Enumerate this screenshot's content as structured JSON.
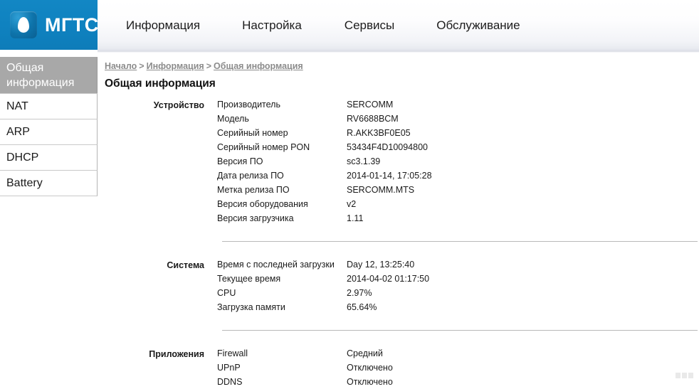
{
  "brand": {
    "name": "МГТС",
    "logo_icon": "egg-drop-icon",
    "logo_bg_color": "#0f82c0"
  },
  "nav": {
    "items": [
      {
        "label": "Информация"
      },
      {
        "label": "Настройка"
      },
      {
        "label": "Сервисы"
      },
      {
        "label": "Обслуживание"
      }
    ]
  },
  "sidebar": {
    "items": [
      {
        "label": "Общая информация",
        "active": true
      },
      {
        "label": "NAT",
        "active": false
      },
      {
        "label": "ARP",
        "active": false
      },
      {
        "label": "DHCP",
        "active": false
      },
      {
        "label": "Battery",
        "active": false
      }
    ],
    "active_bg_color": "#a8a8a8"
  },
  "breadcrumb": {
    "items": [
      {
        "label": "Начало"
      },
      {
        "label": "Информация"
      },
      {
        "label": "Общая информация"
      }
    ],
    "separator": ">"
  },
  "page": {
    "title": "Общая информация"
  },
  "sections": [
    {
      "label": "Устройство",
      "rows": [
        {
          "key": "Производитель",
          "value": "SERCOMM"
        },
        {
          "key": "Модель",
          "value": "RV6688BCM"
        },
        {
          "key": "Серийный номер",
          "value": "R.AKK3BF0E05"
        },
        {
          "key": "Серийный номер PON",
          "value": "53434F4D10094800"
        },
        {
          "key": "Версия ПО",
          "value": "sc3.1.39"
        },
        {
          "key": "Дата релиза ПО",
          "value": "2014-01-14, 17:05:28"
        },
        {
          "key": "Метка релиза ПО",
          "value": "SERCOMM.MTS"
        },
        {
          "key": "Версия оборудования",
          "value": "v2"
        },
        {
          "key": "Версия загрузчика",
          "value": "1.11"
        }
      ]
    },
    {
      "label": "Система",
      "rows": [
        {
          "key": "Время с последней загрузки",
          "value": "Day 12, 13:25:40"
        },
        {
          "key": "Текущее время",
          "value": "2014-04-02 01:17:50"
        },
        {
          "key": "CPU",
          "value": "2.97%"
        },
        {
          "key": "Загрузка памяти",
          "value": "65.64%"
        }
      ]
    },
    {
      "label": "Приложения",
      "rows": [
        {
          "key": "Firewall",
          "value": "Средний"
        },
        {
          "key": "UPnP",
          "value": "Отключено"
        },
        {
          "key": "DDNS",
          "value": "Отключено"
        }
      ]
    }
  ]
}
